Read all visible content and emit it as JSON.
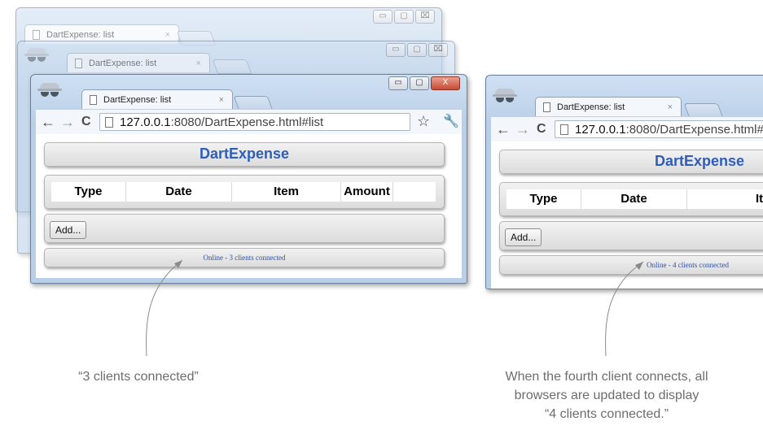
{
  "browser": {
    "tab_title": "DartExpense: list",
    "tab_close": "×",
    "url_host": "127.0.0.1",
    "url_path": ":8080/DartExpense.html#list",
    "url_path_cropped": ":8080/DartExpense.html#",
    "window_controls": {
      "minimize": "▭",
      "maximize": "▢",
      "close": "X",
      "close_inactive": "⌧"
    },
    "icons": {
      "back": "←",
      "forward": "→",
      "reload": "C",
      "star": "☆",
      "wrench": "🔧"
    }
  },
  "app": {
    "title": "DartExpense",
    "columns": [
      "Type",
      "Date",
      "Item",
      "Amount"
    ],
    "add_button": "Add...",
    "status_3": "Online - 3 clients connected",
    "status_4": "Online - 4 clients connected"
  },
  "annotations": {
    "left": "“3 clients connected”",
    "right_line1": "When the fourth client connects, all",
    "right_line2": "browsers are updated to display",
    "right_line3": "“4 clients connected.”"
  },
  "colors": {
    "accent": "#2f5db8",
    "annotation_text": "#6d6d6d",
    "frame": "#b9cfe8"
  }
}
